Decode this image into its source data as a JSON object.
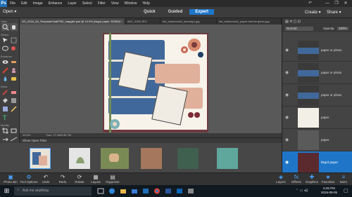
{
  "app": {
    "logo": "Ps",
    "menu": [
      "File",
      "Edit",
      "Image",
      "Enhance",
      "Layer",
      "Select",
      "Filter",
      "View",
      "Window",
      "Help"
    ],
    "undo_icon": "undo-history-icon",
    "window_controls": [
      "—",
      "❐",
      "✕"
    ]
  },
  "modebar": {
    "open_label": "Open ▾",
    "modes": [
      "Quick",
      "Guided",
      "Expert"
    ],
    "active_mode": "Expert",
    "create_label": "Create ▾",
    "share_label": "Share ▾"
  },
  "tools": {
    "sections": [
      "View",
      "Select",
      "Enhance",
      "Draw",
      "Modify",
      "Color"
    ],
    "foreground_color": "#5a2a2a",
    "background_color": "#ffffff"
  },
  "doc_tabs": [
    {
      "label": "GS_2016_09_TemplateChallPSD_mapgifx.psd @ 10.9% (bkgrd paper, RGB/8) *",
      "active": true
    },
    {
      "label": "IMG_3106.JPG",
      "active": false
    },
    {
      "label": "ink_autumnchic_woodsp1.jpg",
      "active": false
    },
    {
      "label": "ink_autumnchic_paper-hermin green.jpg",
      "active": false
    }
  ],
  "status": {
    "zoom": "10.9%",
    "doc_info": "Doc: 17.1M/130.7M"
  },
  "bin": {
    "dropdown_label": "Show Open Files"
  },
  "panel": {
    "blend_mode": "Normal",
    "opacity_label": "Opacity:",
    "opacity_value": "100%",
    "layers": [
      {
        "name": "paper or photo",
        "color": "#41689a"
      },
      {
        "name": "paper or photo",
        "color": "#41689a"
      },
      {
        "name": "paper or photo",
        "color": "#41689a"
      },
      {
        "name": "paper",
        "color": "#f2efe6"
      },
      {
        "name": "paper",
        "color": "#5a5a5a"
      },
      {
        "name": "bkgrd paper",
        "color": "#5b2a2f",
        "selected": true
      }
    ]
  },
  "bottombar": {
    "left": [
      {
        "label": "Photo Bin",
        "icon": "photo-bin-icon"
      },
      {
        "label": "Tool Options",
        "icon": "tool-options-icon"
      },
      {
        "label": "Undo",
        "icon": "undo-icon"
      },
      {
        "label": "Redo",
        "icon": "redo-icon"
      },
      {
        "label": "Rotate",
        "icon": "rotate-icon"
      },
      {
        "label": "Layout",
        "icon": "layout-icon"
      },
      {
        "label": "Organizer",
        "icon": "organizer-icon"
      }
    ],
    "right": [
      {
        "label": "Layers",
        "icon": "layers-icon"
      },
      {
        "label": "Effects",
        "icon": "effects-icon"
      },
      {
        "label": "Graphics",
        "icon": "graphics-icon"
      },
      {
        "label": "Favorites",
        "icon": "favorites-icon"
      },
      {
        "label": "More",
        "icon": "more-icon"
      }
    ]
  },
  "taskbar": {
    "search_placeholder": "Ask me anything",
    "time": "6:25 PM",
    "date": "2016-09-05"
  }
}
